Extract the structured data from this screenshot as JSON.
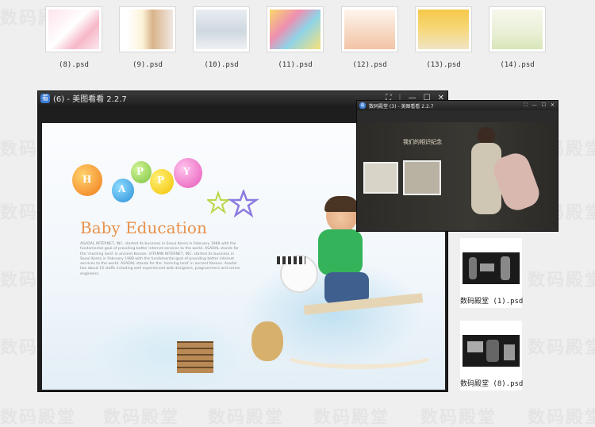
{
  "watermark_text": "数码殿堂",
  "thumbnails": [
    {
      "caption": "(8).psd"
    },
    {
      "caption": "(9).psd"
    },
    {
      "caption": "(10).psd"
    },
    {
      "caption": "(11).psd"
    },
    {
      "caption": "(12).psd"
    },
    {
      "caption": "(13).psd"
    },
    {
      "caption": "(14).psd"
    }
  ],
  "main_window": {
    "title": "(6) - 美图看看 2.2.7",
    "photo": {
      "balloon_letters": [
        "H",
        "A",
        "P",
        "P",
        "Y"
      ],
      "heading": "Baby Education",
      "body": "ASADAL INTERNET, INC. started its business in Seoul Korea in February 1988 with the fundamental goal of providing better internet services to the world. ASADAL stands for the 'morning land' in ancient Korean. VITAMIN INTERNET, INC. started its business in Seoul Korea in February 1988 with the fundamental goal of providing better internet services to the world. ASADAL stands for the 'morning land' in ancient Korean. Asadal has about 15 staffs including well experienced web designers, programmers and server engineers."
    }
  },
  "second_window": {
    "title": "数码殿堂 (3) - 美图看看 2.2.7",
    "photo_text": "我们的相识纪念"
  },
  "side_files": [
    {
      "caption": "数码殿堂 (1).psd"
    },
    {
      "caption": "数码殿堂 (8).psd"
    }
  ],
  "colors": {
    "heading": "#e8914a",
    "window_bg": "#1e1e1e"
  }
}
